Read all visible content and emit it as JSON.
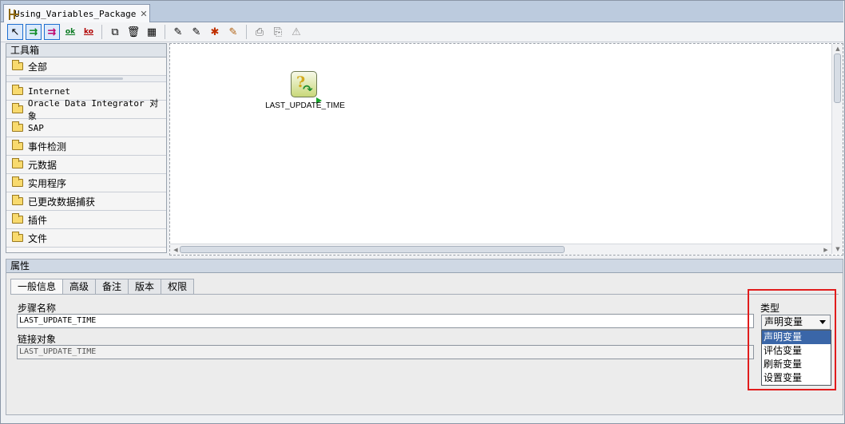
{
  "tab": {
    "title": "Using_Variables_Package",
    "close": "✕"
  },
  "toolbar": {
    "ok_label": "ok",
    "ko_label": "ko"
  },
  "toolbox": {
    "title": "工具箱",
    "categories": [
      {
        "label": "全部"
      },
      {
        "label": "Internet"
      },
      {
        "label": "Oracle Data Integrator 对象"
      },
      {
        "label": "SAP"
      },
      {
        "label": "事件检测"
      },
      {
        "label": "元数据"
      },
      {
        "label": "实用程序"
      },
      {
        "label": "已更改数据捕获"
      },
      {
        "label": "插件"
      },
      {
        "label": "文件"
      }
    ]
  },
  "diagram": {
    "step_label": "LAST_UPDATE_TIME"
  },
  "properties": {
    "title": "属性",
    "tabs": [
      "一般信息",
      "高级",
      "备注",
      "版本",
      "权限"
    ],
    "step_name_label": "步骤名称",
    "step_name_value": "LAST_UPDATE_TIME",
    "linked_object_label": "链接对象",
    "linked_object_value": "LAST_UPDATE_TIME",
    "type_label": "类型",
    "type_selected": "声明变量",
    "type_options": [
      "声明变量",
      "评估变量",
      "刷新变量",
      "设置变量"
    ]
  },
  "colors": {
    "highlight_border": "#e11c1c",
    "selected_option_bg": "#3a66a8"
  }
}
